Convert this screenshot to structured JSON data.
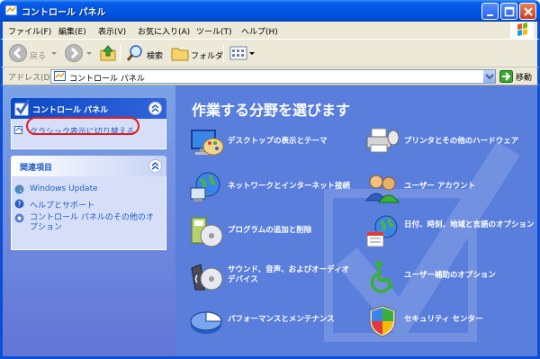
{
  "window": {
    "title": "コントロール パネル",
    "buttons": {
      "minimize": "minimize",
      "maximize": "maximize",
      "close": "close"
    }
  },
  "menu": [
    "ファイル(F)",
    "編集(E)",
    "表示(V)",
    "お気に入り(A)",
    "ツール(T)",
    "ヘルプ(H)"
  ],
  "toolbar": {
    "back_label": "戻る",
    "search_label": "検索",
    "folder_label": "フォルダ"
  },
  "address": {
    "label": "アドレス(D)",
    "value": "コントロール パネル",
    "go_label": "移動"
  },
  "sidebar": {
    "primary_panel": {
      "title": "コントロール パネル",
      "task": "クラシック表示に切り替える"
    },
    "related_panel": {
      "title": "関連項目",
      "links": [
        "Windows Update",
        "ヘルプとサポート",
        "コントロール パネルのその他のオプション"
      ]
    }
  },
  "content": {
    "heading": "作業する分野を選びます",
    "categories": [
      {
        "label": "デスクトップの表示とテーマ",
        "icon": "desktop-theme-icon"
      },
      {
        "label": "プリンタとその他のハードウェア",
        "icon": "printer-icon"
      },
      {
        "label": "ネットワークとインターネット接続",
        "icon": "network-globe-icon"
      },
      {
        "label": "ユーザー アカウント",
        "icon": "user-accounts-icon"
      },
      {
        "label": "プログラムの追加と削除",
        "icon": "add-remove-programs-icon"
      },
      {
        "label": "日付、時刻、地域と言語のオプション",
        "icon": "date-time-globe-icon"
      },
      {
        "label": "サウンド、音声、およびオーディオ デバイス",
        "icon": "speaker-icon"
      },
      {
        "label": "ユーザー補助のオプション",
        "icon": "accessibility-icon"
      },
      {
        "label": "パフォーマンスとメンテナンス",
        "icon": "pie-chart-icon"
      },
      {
        "label": "セキュリティ センター",
        "icon": "security-shield-icon"
      }
    ]
  },
  "colors": {
    "titlebar": "#0054e3",
    "sidebar_bg": "#7ba2e7",
    "content_bg": "#5a7edc",
    "link": "#215dc6",
    "highlight": "#e31c1c"
  }
}
